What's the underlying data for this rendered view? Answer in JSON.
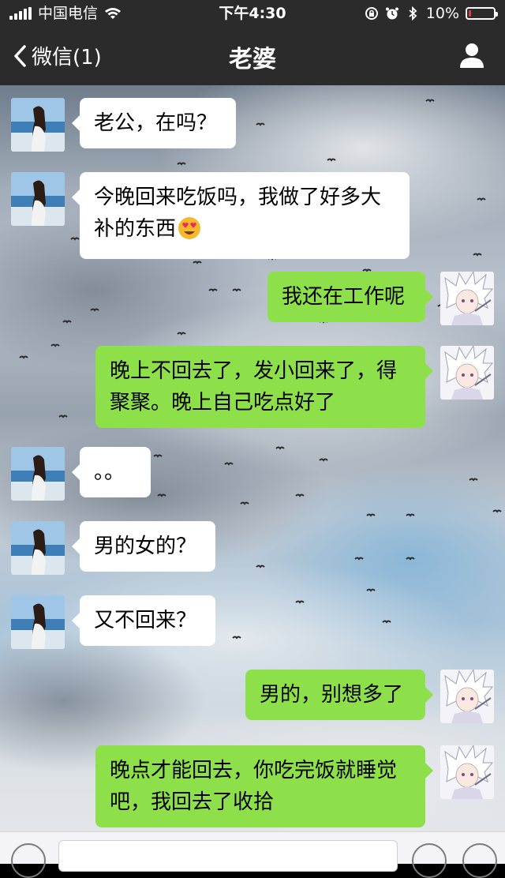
{
  "status_bar": {
    "carrier": "中国电信",
    "time": "下午4:30",
    "battery_text": "10%",
    "battery_level": 0.1
  },
  "nav": {
    "back_label": "微信(1)",
    "title": "老婆"
  },
  "messages": [
    {
      "side": "in",
      "text_lines": [
        "老公，在吗？"
      ]
    },
    {
      "side": "in",
      "text_lines": [
        "今晚回来吃饭吗，我做了好多大",
        "补的东西"
      ],
      "emoji": "heart-eyes-emoji"
    },
    {
      "side": "out",
      "text_lines": [
        "我还在工作呢"
      ]
    },
    {
      "side": "out",
      "text_lines": [
        "晚上不回去了，发小回来了，得",
        "聚聚。晚上自己吃点好了"
      ]
    },
    {
      "side": "in",
      "text_lines": [
        "。。"
      ]
    },
    {
      "side": "in",
      "text_lines": [
        "男的女的？"
      ]
    },
    {
      "side": "in",
      "text_lines": [
        "又不回来？"
      ]
    },
    {
      "side": "out",
      "text_lines": [
        "男的，别想多了"
      ]
    },
    {
      "side": "out",
      "text_lines": [
        "晚点才能回去，你吃完饭就睡觉",
        "吧，我回去了收拾"
      ]
    }
  ],
  "colors": {
    "nav_bg": "#2b2b2b",
    "incoming_bubble": "#ffffff",
    "outgoing_bubble": "#8de04a",
    "battery_low": "#e23c3c"
  },
  "icons": [
    "back-chevron-icon",
    "profile-icon",
    "voice-icon",
    "emoji-icon",
    "plus-icon",
    "wifi-icon",
    "alarm-icon",
    "bluetooth-icon",
    "lock-rotation-icon"
  ]
}
